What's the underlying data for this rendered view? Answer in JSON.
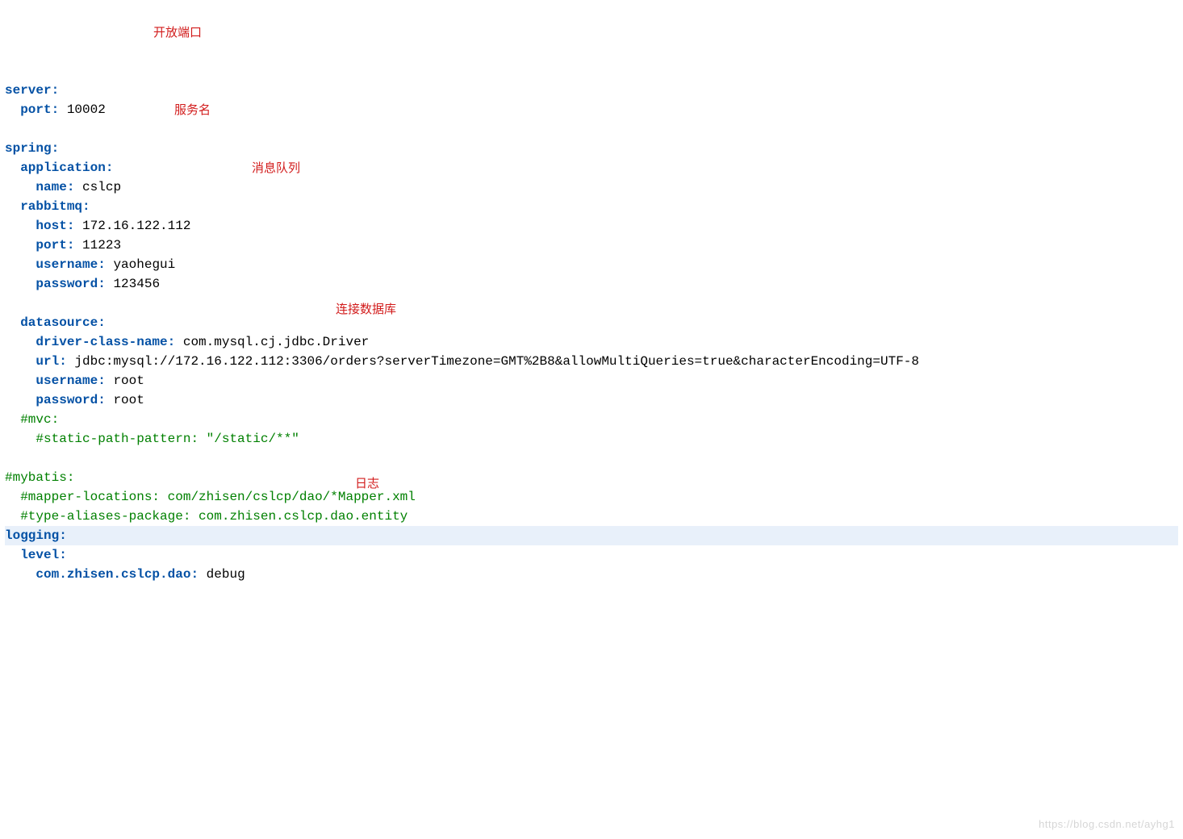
{
  "lines": {
    "l1_k": "server:",
    "l2_k": "port:",
    "l2_v": "10002",
    "l3_k": "spring:",
    "l4_k": "application:",
    "l5_k": "name:",
    "l5_v": "cslcp",
    "l6_k": "rabbitmq:",
    "l7_k": "host:",
    "l7_v": "172.16.122.112",
    "l8_k": "port:",
    "l8_v": "11223",
    "l9_k": "username:",
    "l9_v": "yaohegui",
    "l10_k": "password:",
    "l10_v": "123456",
    "l11_k": "datasource:",
    "l12_k": "driver-class-name:",
    "l12_v": "com.mysql.cj.jdbc.Driver",
    "l13_k": "url:",
    "l13_v": "jdbc:mysql://172.16.122.112:3306/orders?serverTimezone=GMT%2B8&allowMultiQueries=true&characterEncoding=UTF-8",
    "l14_k": "username:",
    "l14_v": "root",
    "l15_k": "password:",
    "l15_v": "root",
    "l16_c": "#mvc:",
    "l17_c": "#static-path-pattern: \"/static/**\"",
    "l18_c": "#mybatis:",
    "l19_c": "#mapper-locations: com/zhisen/cslcp/dao/*Mapper.xml",
    "l20_c": "#type-aliases-package: com.zhisen.cslcp.dao.entity",
    "l21_k": "logging:",
    "l22_k": "level:",
    "l23_k": "com.zhisen.cslcp.dao:",
    "l23_v": "debug"
  },
  "ann": {
    "a1": "开放端口",
    "a2": "服务名",
    "a3": "消息队列",
    "a4": "连接数据库",
    "a5": "日志"
  },
  "watermark": "https://blog.csdn.net/ayhg1"
}
